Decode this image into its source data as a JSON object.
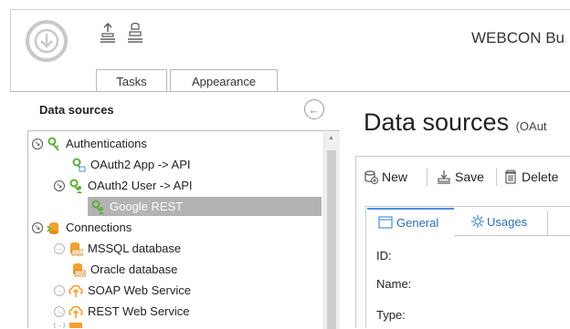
{
  "app": {
    "title": "WEBCON Bu"
  },
  "ribbon": {
    "tabs": [
      "Tasks",
      "Appearance"
    ],
    "icons": [
      "download-circle-icon",
      "export-icon",
      "import-icon"
    ]
  },
  "left_panel": {
    "title": "Data sources",
    "tree": [
      {
        "label": "Authentications",
        "icon": "key-group-icon",
        "expander": "collapse"
      },
      {
        "label": "OAuth2 App -> API",
        "icon": "key-icon"
      },
      {
        "label": "OAuth2 User -> API",
        "icon": "key-user-icon",
        "expander": "collapse"
      },
      {
        "label": "Google REST",
        "icon": "key-user-icon",
        "selected": true
      },
      {
        "label": "Connections",
        "icon": "connections-icon",
        "expander": "collapse"
      },
      {
        "label": "MSSQL database",
        "icon": "database-sql-icon",
        "expander": "expand"
      },
      {
        "label": "Oracle database",
        "icon": "database-ora-icon"
      },
      {
        "label": "SOAP Web Service",
        "icon": "cloud-upload-icon",
        "expander": "expand"
      },
      {
        "label": "REST Web Service",
        "icon": "cloud-upload-icon",
        "expander": "expand"
      }
    ]
  },
  "right_panel": {
    "title": "Data sources",
    "subtitle": "(OAut",
    "toolbar": {
      "new": "New",
      "save": "Save",
      "delete": "Delete"
    },
    "form_tabs": [
      "General",
      "Usages"
    ],
    "fields": [
      "ID:",
      "Name:",
      "Type:"
    ]
  },
  "colors": {
    "accent": "#4a90d9",
    "key_green": "#5fae3a",
    "db_orange": "#f0a030",
    "selection": "#b3b3b3"
  }
}
